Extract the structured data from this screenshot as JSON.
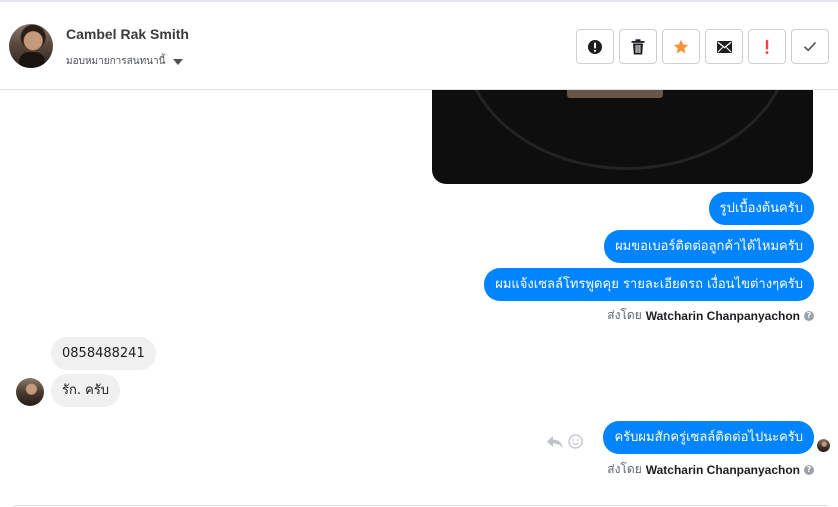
{
  "header": {
    "contact_name": "Cambel Rak Smith",
    "assign_label": "มอบหมายการสนทนานี้"
  },
  "toolbar": {
    "buttons": [
      {
        "name": "spam",
        "icon": "exclamation-circle-icon"
      },
      {
        "name": "delete",
        "icon": "trash-icon"
      },
      {
        "name": "star",
        "icon": "star-icon",
        "color": "#f7923b"
      },
      {
        "name": "mark-unread",
        "icon": "envelope-icon"
      },
      {
        "name": "follow-up",
        "icon": "exclamation-icon",
        "color": "#fa3e3e"
      },
      {
        "name": "done",
        "icon": "checkmark-icon"
      }
    ]
  },
  "messages": {
    "out1": "รูปเบื้องต้นครับ",
    "out2": "ผมขอเบอร์ติดต่อลูกค้าได้ไหมครับ",
    "out3": "ผมแจ้งเซลล์โทรพูดคุย รายละเอียดรถ เงื่อนไขต่างๆครับ",
    "in1": "0858488241",
    "in2": "รัก. ครับ",
    "out4": "ครับผมสักครู่เซลล์ติดต่อไปนะครับ"
  },
  "sent_by": {
    "prefix": "ส่งโดย",
    "name": "Watcharin Chanpanyachon",
    "help_glyph": "?"
  },
  "colors": {
    "outgoing_bubble": "#0084ff",
    "incoming_bubble": "#f0f0f0"
  }
}
